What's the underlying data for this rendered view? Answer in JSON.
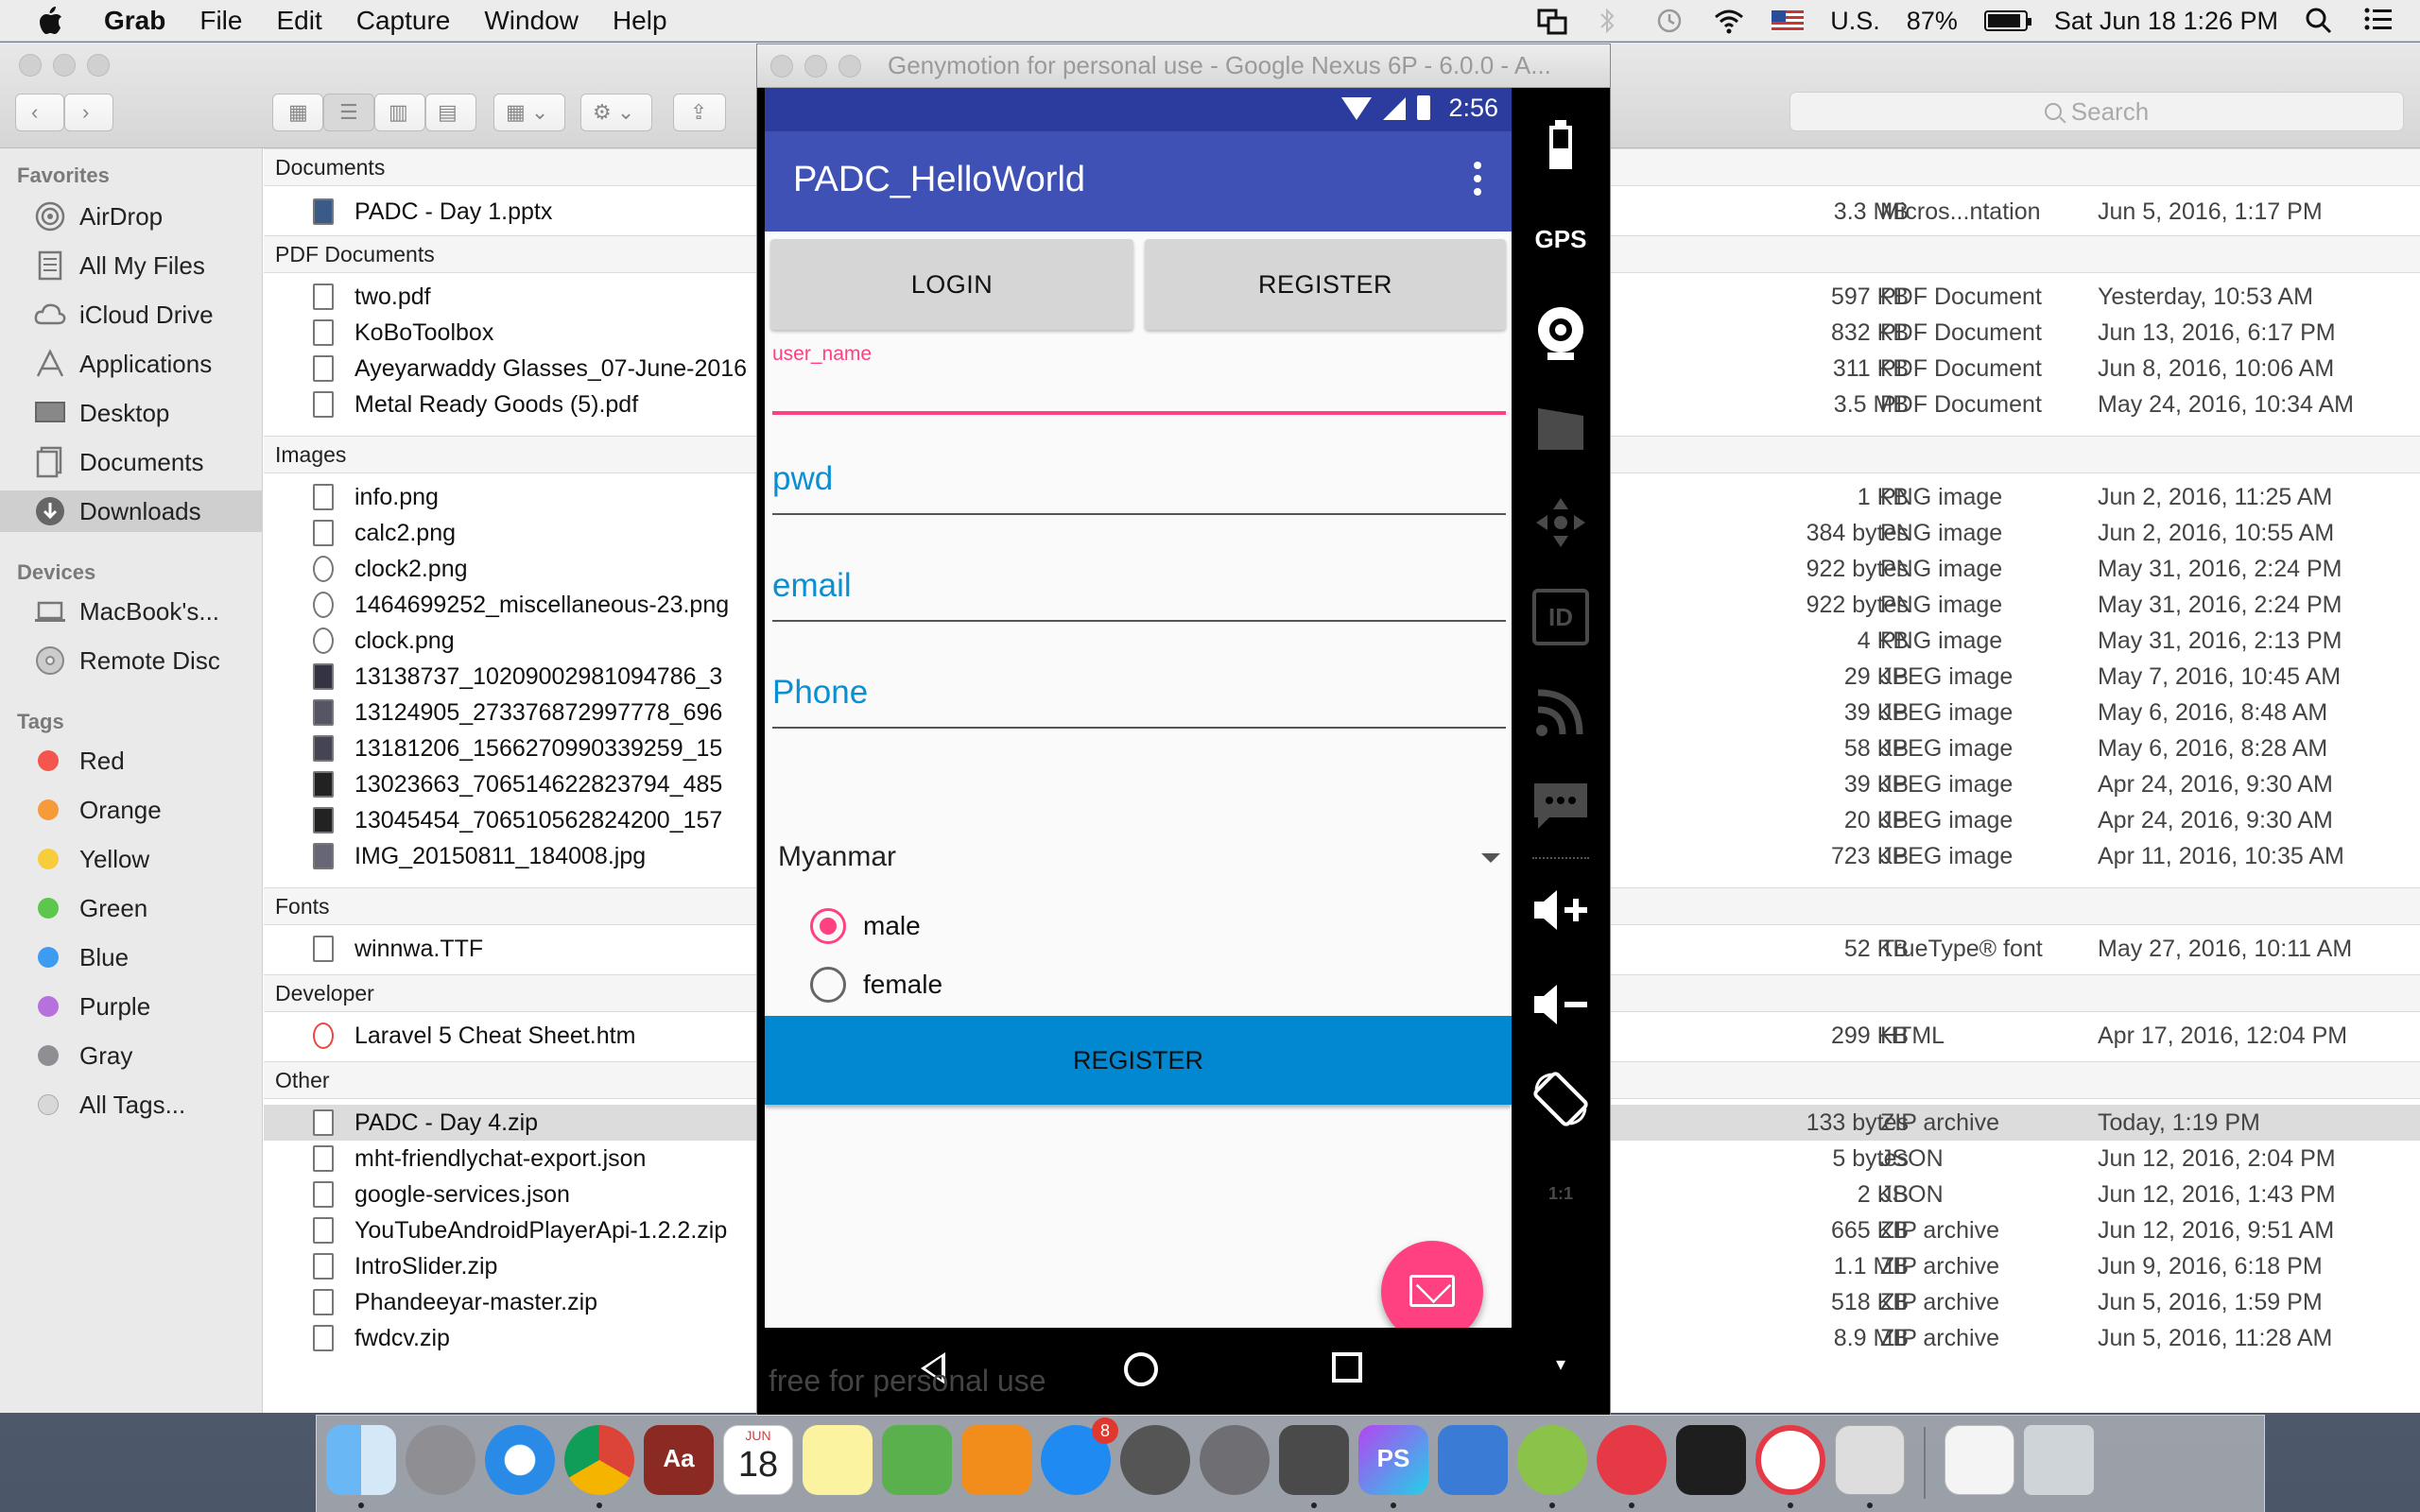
{
  "menubar": {
    "app_name": "Grab",
    "items": [
      "File",
      "Edit",
      "Capture",
      "Window",
      "Help"
    ],
    "input_source": "U.S.",
    "battery": "87%",
    "datetime": "Sat Jun 18  1:26 PM"
  },
  "finder": {
    "search_placeholder": "Search",
    "sidebar": {
      "favorites_heading": "Favorites",
      "favorites": [
        "AirDrop",
        "All My Files",
        "iCloud Drive",
        "Applications",
        "Desktop",
        "Documents",
        "Downloads"
      ],
      "devices_heading": "Devices",
      "devices": [
        "MacBook's...",
        "Remote Disc"
      ],
      "tags_heading": "Tags",
      "tags": [
        {
          "label": "Red",
          "color": "#f4554d"
        },
        {
          "label": "Orange",
          "color": "#f79a3a"
        },
        {
          "label": "Yellow",
          "color": "#f7cd3c"
        },
        {
          "label": "Green",
          "color": "#5cc64d"
        },
        {
          "label": "Blue",
          "color": "#3d9bf2"
        },
        {
          "label": "Purple",
          "color": "#b671dc"
        },
        {
          "label": "Gray",
          "color": "#8e8e93"
        },
        {
          "label": "All Tags...",
          "color": "#d8d8d8"
        }
      ]
    },
    "groups": {
      "documents": "Documents",
      "pdf": "PDF Documents",
      "images": "Images",
      "fonts": "Fonts",
      "developer": "Developer",
      "other": "Other"
    },
    "files": {
      "presentations": [
        {
          "name": "PADC - Day 1.pptx",
          "size": "3.3 MB",
          "kind": "Micros...ntation",
          "date": "Jun 5, 2016, 1:17 PM"
        }
      ],
      "pdf": [
        {
          "name": "two.pdf",
          "size": "597 KB",
          "kind": "PDF Document",
          "date": "Yesterday, 10:53 AM"
        },
        {
          "name": "KoBoToolbox",
          "size": "832 KB",
          "kind": "PDF Document",
          "date": "Jun 13, 2016, 6:17 PM"
        },
        {
          "name": "Ayeyarwaddy Glasses_07-June-2016",
          "size": "311 KB",
          "kind": "PDF Document",
          "date": "Jun 8, 2016, 10:06 AM"
        },
        {
          "name": "Metal Ready Goods (5).pdf",
          "size": "3.5 MB",
          "kind": "PDF Document",
          "date": "May 24, 2016, 10:34 AM"
        }
      ],
      "images": [
        {
          "name": "info.png",
          "size": "1 KB",
          "kind": "PNG image",
          "date": "Jun 2, 2016, 11:25 AM"
        },
        {
          "name": "calc2.png",
          "size": "384 bytes",
          "kind": "PNG image",
          "date": "Jun 2, 2016, 10:55 AM"
        },
        {
          "name": "clock2.png",
          "size": "922 bytes",
          "kind": "PNG image",
          "date": "May 31, 2016, 2:24 PM"
        },
        {
          "name": "1464699252_miscellaneous-23.png",
          "size": "922 bytes",
          "kind": "PNG image",
          "date": "May 31, 2016, 2:24 PM"
        },
        {
          "name": "clock.png",
          "size": "4 KB",
          "kind": "PNG image",
          "date": "May 31, 2016, 2:13 PM"
        },
        {
          "name": "13138737_10209002981094786_3",
          "size": "29 KB",
          "kind": "JPEG image",
          "date": "May 7, 2016, 10:45 AM"
        },
        {
          "name": "13124905_273376872997778_696",
          "size": "39 KB",
          "kind": "JPEG image",
          "date": "May 6, 2016, 8:48 AM"
        },
        {
          "name": "13181206_1566270990339259_15",
          "size": "58 KB",
          "kind": "JPEG image",
          "date": "May 6, 2016, 8:28 AM"
        },
        {
          "name": "13023663_706514622823794_485",
          "size": "39 KB",
          "kind": "JPEG image",
          "date": "Apr 24, 2016, 9:30 AM"
        },
        {
          "name": "13045454_706510562824200_157",
          "size": "20 KB",
          "kind": "JPEG image",
          "date": "Apr 24, 2016, 9:30 AM"
        },
        {
          "name": "IMG_20150811_184008.jpg",
          "size": "723 KB",
          "kind": "JPEG image",
          "date": "Apr 11, 2016, 10:35 AM"
        }
      ],
      "fonts": [
        {
          "name": "winnwa.TTF",
          "size": "52 KB",
          "kind": "TrueType® font",
          "date": "May 27, 2016, 10:11 AM"
        }
      ],
      "developer": [
        {
          "name": "Laravel 5 Cheat Sheet.htm",
          "size": "299 KB",
          "kind": "HTML",
          "date": "Apr 17, 2016, 12:04 PM"
        }
      ],
      "other": [
        {
          "name": "PADC - Day 4.zip",
          "size": "133 bytes",
          "kind": "ZIP archive",
          "date": "Today, 1:19 PM"
        },
        {
          "name": "mht-friendlychat-export.json",
          "size": "5 bytes",
          "kind": "JSON",
          "date": "Jun 12, 2016, 2:04 PM"
        },
        {
          "name": "google-services.json",
          "size": "2 KB",
          "kind": "JSON",
          "date": "Jun 12, 2016, 1:43 PM"
        },
        {
          "name": "YouTubeAndroidPlayerApi-1.2.2.zip",
          "size": "665 KB",
          "kind": "ZIP archive",
          "date": "Jun 12, 2016, 9:51 AM"
        },
        {
          "name": "IntroSlider.zip",
          "size": "1.1 MB",
          "kind": "ZIP archive",
          "date": "Jun 9, 2016, 6:18 PM"
        },
        {
          "name": "Phandeeyar-master.zip",
          "size": "518 KB",
          "kind": "ZIP archive",
          "date": "Jun 5, 2016, 1:59 PM"
        },
        {
          "name": "fwdcv.zip",
          "size": "8.9 MB",
          "kind": "ZIP archive",
          "date": "Jun 5, 2016, 11:28 AM"
        }
      ]
    }
  },
  "genymotion": {
    "window_title": "Genymotion for personal use - Google Nexus 6P - 6.0.0 - A...",
    "watermark": "free for personal use",
    "panel_labels": {
      "gps": "GPS",
      "id": "ID",
      "pixel": "1:1"
    },
    "phone": {
      "clock": "2:56",
      "app_title": "PADC_HelloWorld",
      "login_button": "LOGIN",
      "register_tab_button": "REGISTER",
      "username_label": "user_name",
      "password_hint": "pwd",
      "email_hint": "email",
      "phone_hint": "Phone",
      "country_selected": "Myanmar",
      "gender_options": [
        "male",
        "female"
      ],
      "gender_selected": "male",
      "register_button": "REGISTER"
    }
  },
  "dock": {
    "calendar_month": "JUN",
    "calendar_day": "18",
    "appstore_badge": "8",
    "dictionary_label": "Aa",
    "phpstorm_label": "PS"
  }
}
